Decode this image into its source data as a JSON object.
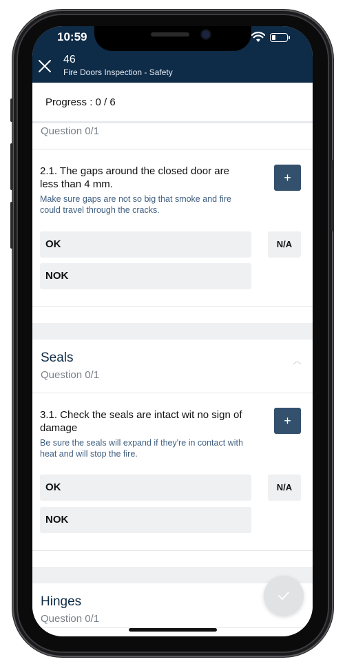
{
  "status": {
    "time": "10:59"
  },
  "header": {
    "number": "46",
    "subtitle": "Fire Doors Inspection - Safety"
  },
  "progress": {
    "label": "Progress : 0 / 6"
  },
  "previous_section": {
    "question_count": "Question 0/1"
  },
  "questions": [
    {
      "text": "2.1. The gaps around the closed door are less than 4 mm.",
      "hint": "Make sure gaps are not so big that smoke and fire could travel through the cracks.",
      "add_label": "+",
      "ok_label": "OK",
      "nok_label": "NOK",
      "na_label": "N/A"
    },
    {
      "text": "3.1. Check the seals are intact wit no sign of damage",
      "hint": "Be sure the seals will expand if they're in contact with heat and will stop the fire.",
      "add_label": "+",
      "ok_label": "OK",
      "nok_label": "NOK",
      "na_label": "N/A"
    }
  ],
  "sections": [
    {
      "title": "Seals",
      "question_count": "Question 0/1",
      "collapse_icon": "chevron-up-icon"
    },
    {
      "title": "Hinges",
      "question_count": "Question 0/1"
    }
  ],
  "fab": {
    "icon": "check-icon"
  },
  "colors": {
    "header_bg": "#0e2b47",
    "accent": "#33506d",
    "hint_text": "#3f5f80",
    "option_bg": "#eef0f2"
  }
}
